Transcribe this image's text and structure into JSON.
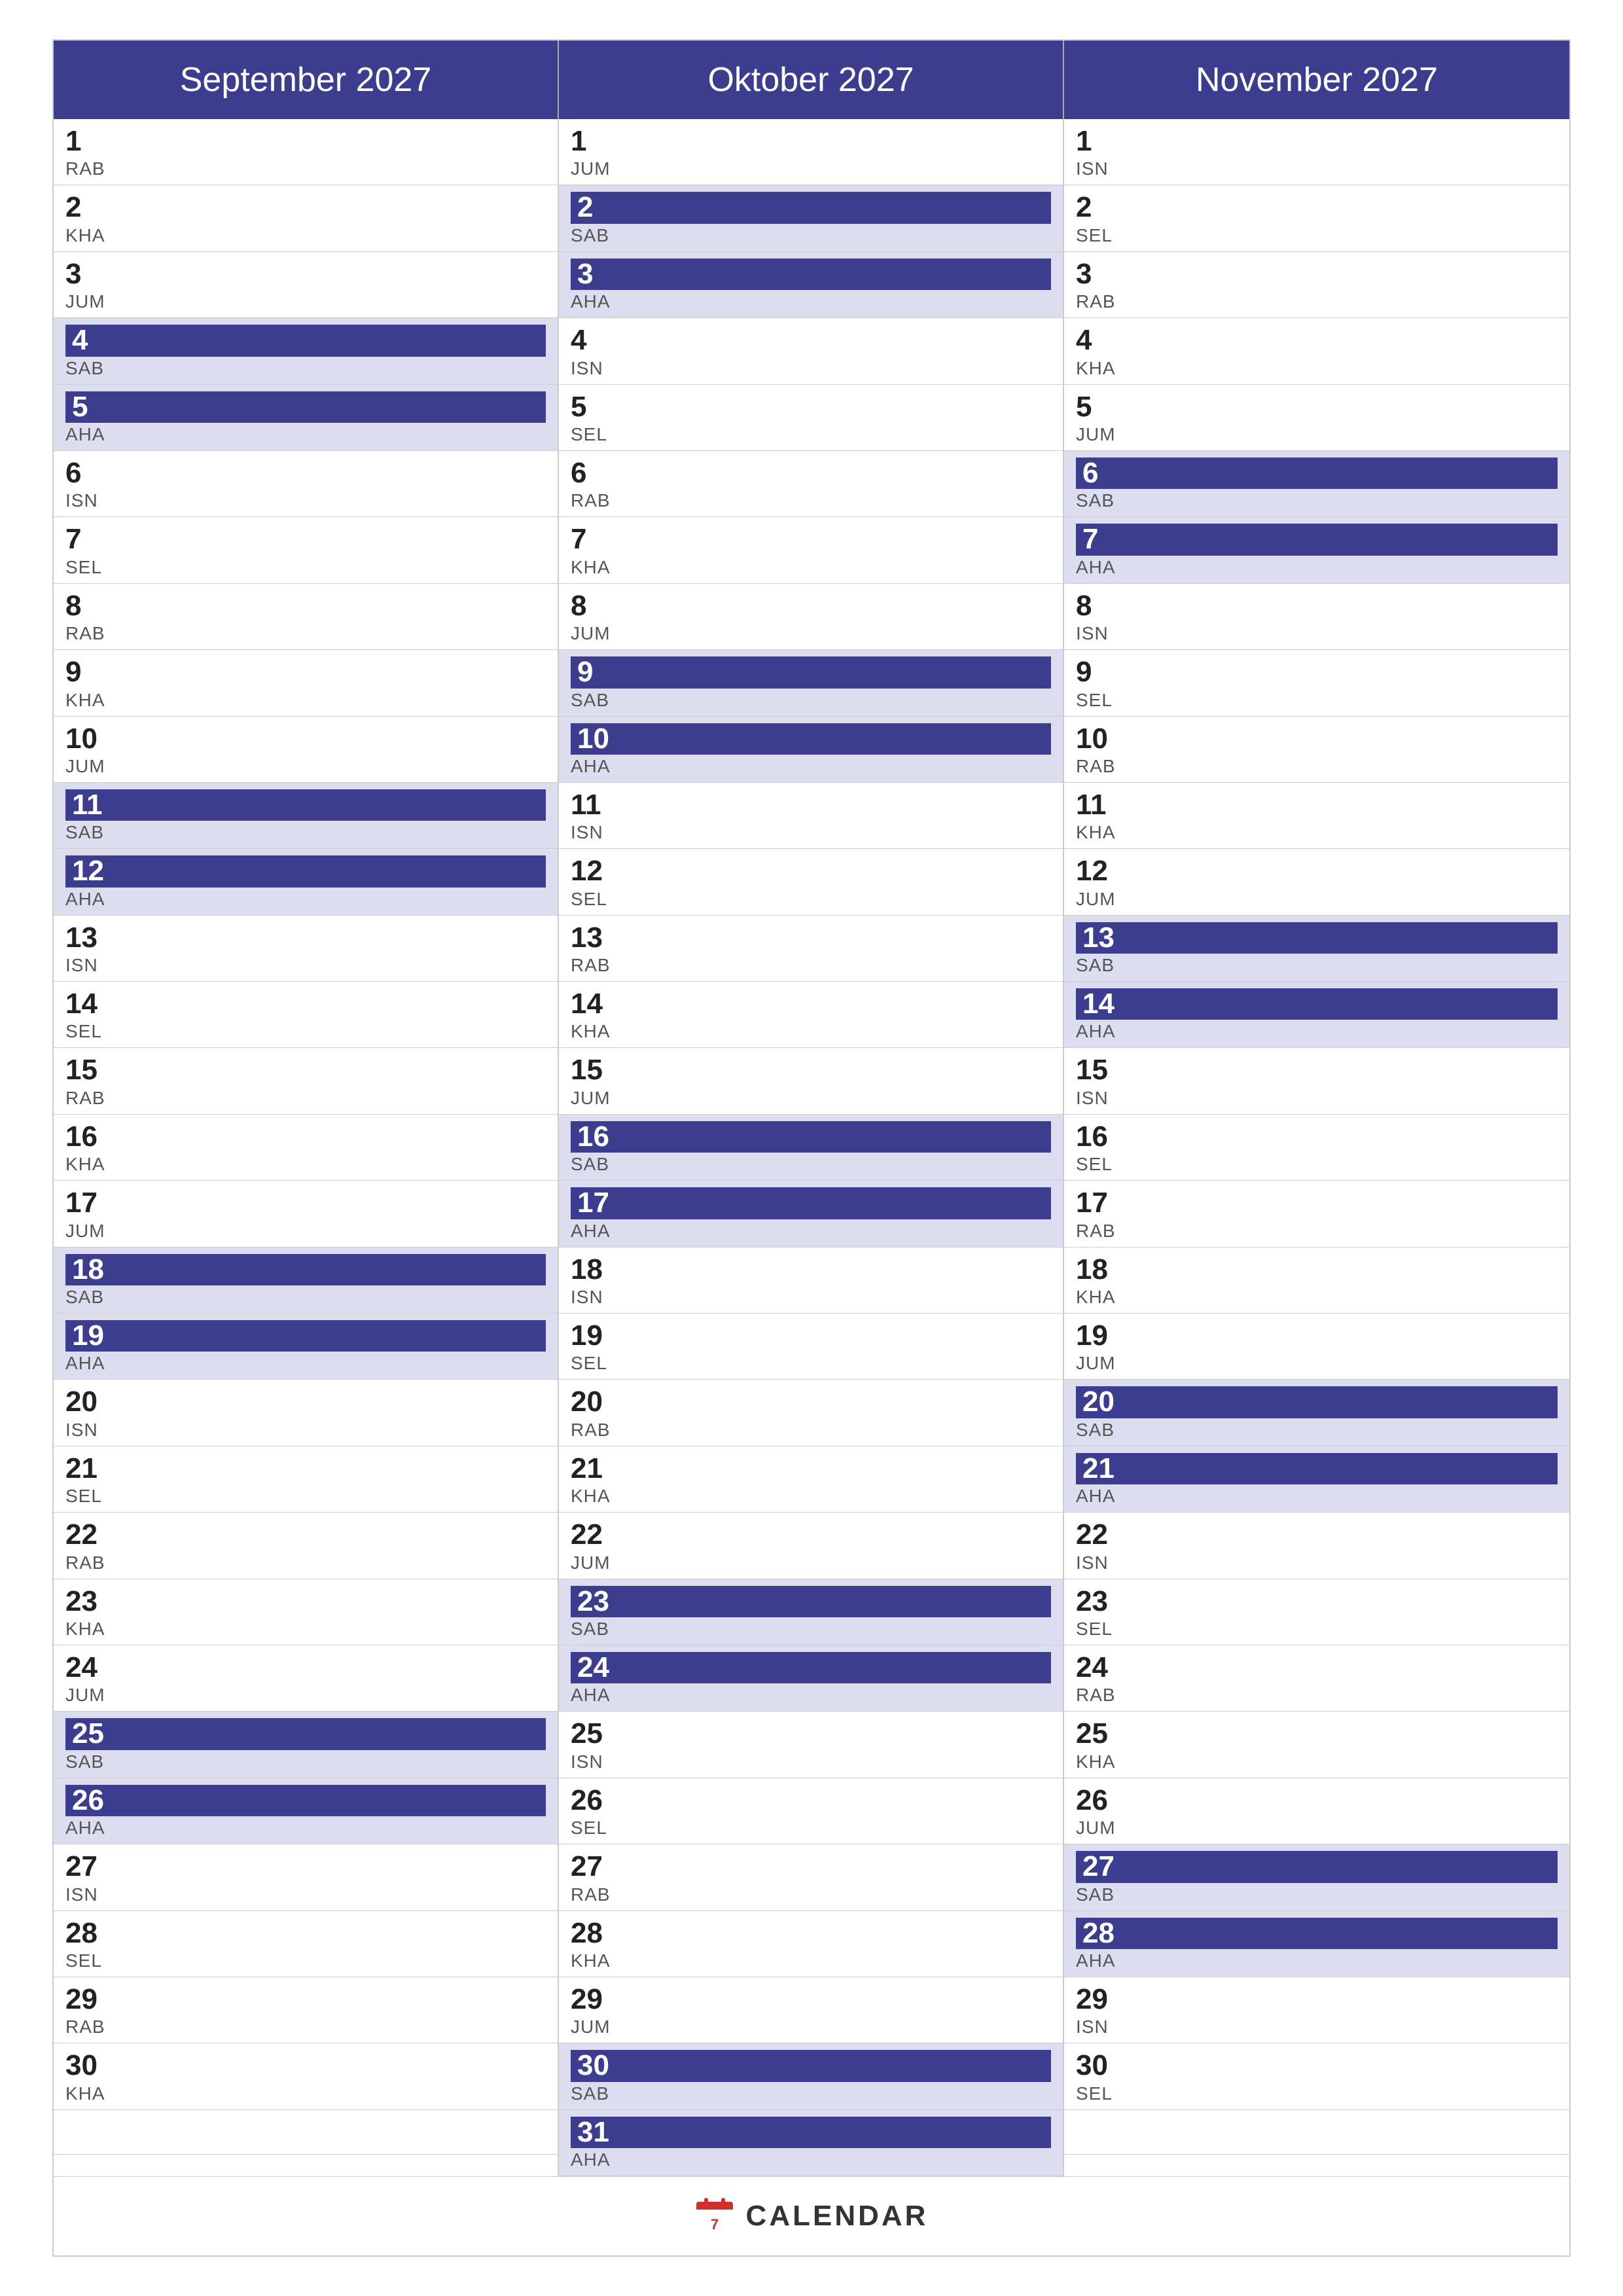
{
  "months": [
    {
      "name": "September 2027",
      "days": [
        {
          "num": "1",
          "label": "RAB",
          "hl": false,
          "hlNum": false
        },
        {
          "num": "2",
          "label": "KHA",
          "hl": false,
          "hlNum": false
        },
        {
          "num": "3",
          "label": "JUM",
          "hl": false,
          "hlNum": false
        },
        {
          "num": "4",
          "label": "SAB",
          "hl": true,
          "hlNum": true
        },
        {
          "num": "5",
          "label": "AHA",
          "hl": true,
          "hlNum": true
        },
        {
          "num": "6",
          "label": "ISN",
          "hl": false,
          "hlNum": false
        },
        {
          "num": "7",
          "label": "SEL",
          "hl": false,
          "hlNum": false
        },
        {
          "num": "8",
          "label": "RAB",
          "hl": false,
          "hlNum": false
        },
        {
          "num": "9",
          "label": "KHA",
          "hl": false,
          "hlNum": false
        },
        {
          "num": "10",
          "label": "JUM",
          "hl": false,
          "hlNum": false
        },
        {
          "num": "11",
          "label": "SAB",
          "hl": true,
          "hlNum": true
        },
        {
          "num": "12",
          "label": "AHA",
          "hl": true,
          "hlNum": true
        },
        {
          "num": "13",
          "label": "ISN",
          "hl": false,
          "hlNum": false
        },
        {
          "num": "14",
          "label": "SEL",
          "hl": false,
          "hlNum": false
        },
        {
          "num": "15",
          "label": "RAB",
          "hl": false,
          "hlNum": false
        },
        {
          "num": "16",
          "label": "KHA",
          "hl": false,
          "hlNum": false
        },
        {
          "num": "17",
          "label": "JUM",
          "hl": false,
          "hlNum": false
        },
        {
          "num": "18",
          "label": "SAB",
          "hl": true,
          "hlNum": true
        },
        {
          "num": "19",
          "label": "AHA",
          "hl": true,
          "hlNum": true
        },
        {
          "num": "20",
          "label": "ISN",
          "hl": false,
          "hlNum": false
        },
        {
          "num": "21",
          "label": "SEL",
          "hl": false,
          "hlNum": false
        },
        {
          "num": "22",
          "label": "RAB",
          "hl": false,
          "hlNum": false
        },
        {
          "num": "23",
          "label": "KHA",
          "hl": false,
          "hlNum": false
        },
        {
          "num": "24",
          "label": "JUM",
          "hl": false,
          "hlNum": false
        },
        {
          "num": "25",
          "label": "SAB",
          "hl": true,
          "hlNum": true
        },
        {
          "num": "26",
          "label": "AHA",
          "hl": true,
          "hlNum": true
        },
        {
          "num": "27",
          "label": "ISN",
          "hl": false,
          "hlNum": false
        },
        {
          "num": "28",
          "label": "SEL",
          "hl": false,
          "hlNum": false
        },
        {
          "num": "29",
          "label": "RAB",
          "hl": false,
          "hlNum": false
        },
        {
          "num": "30",
          "label": "KHA",
          "hl": false,
          "hlNum": false
        }
      ]
    },
    {
      "name": "Oktober 2027",
      "days": [
        {
          "num": "1",
          "label": "JUM",
          "hl": false,
          "hlNum": false
        },
        {
          "num": "2",
          "label": "SAB",
          "hl": true,
          "hlNum": true
        },
        {
          "num": "3",
          "label": "AHA",
          "hl": true,
          "hlNum": true
        },
        {
          "num": "4",
          "label": "ISN",
          "hl": false,
          "hlNum": false
        },
        {
          "num": "5",
          "label": "SEL",
          "hl": false,
          "hlNum": false
        },
        {
          "num": "6",
          "label": "RAB",
          "hl": false,
          "hlNum": false
        },
        {
          "num": "7",
          "label": "KHA",
          "hl": false,
          "hlNum": false
        },
        {
          "num": "8",
          "label": "JUM",
          "hl": false,
          "hlNum": false
        },
        {
          "num": "9",
          "label": "SAB",
          "hl": true,
          "hlNum": true
        },
        {
          "num": "10",
          "label": "AHA",
          "hl": true,
          "hlNum": true
        },
        {
          "num": "11",
          "label": "ISN",
          "hl": false,
          "hlNum": false
        },
        {
          "num": "12",
          "label": "SEL",
          "hl": false,
          "hlNum": false
        },
        {
          "num": "13",
          "label": "RAB",
          "hl": false,
          "hlNum": false
        },
        {
          "num": "14",
          "label": "KHA",
          "hl": false,
          "hlNum": false
        },
        {
          "num": "15",
          "label": "JUM",
          "hl": false,
          "hlNum": false
        },
        {
          "num": "16",
          "label": "SAB",
          "hl": true,
          "hlNum": true
        },
        {
          "num": "17",
          "label": "AHA",
          "hl": true,
          "hlNum": true
        },
        {
          "num": "18",
          "label": "ISN",
          "hl": false,
          "hlNum": false
        },
        {
          "num": "19",
          "label": "SEL",
          "hl": false,
          "hlNum": false
        },
        {
          "num": "20",
          "label": "RAB",
          "hl": false,
          "hlNum": false
        },
        {
          "num": "21",
          "label": "KHA",
          "hl": false,
          "hlNum": false
        },
        {
          "num": "22",
          "label": "JUM",
          "hl": false,
          "hlNum": false
        },
        {
          "num": "23",
          "label": "SAB",
          "hl": true,
          "hlNum": true
        },
        {
          "num": "24",
          "label": "AHA",
          "hl": true,
          "hlNum": true
        },
        {
          "num": "25",
          "label": "ISN",
          "hl": false,
          "hlNum": false
        },
        {
          "num": "26",
          "label": "SEL",
          "hl": false,
          "hlNum": false
        },
        {
          "num": "27",
          "label": "RAB",
          "hl": false,
          "hlNum": false
        },
        {
          "num": "28",
          "label": "KHA",
          "hl": false,
          "hlNum": false
        },
        {
          "num": "29",
          "label": "JUM",
          "hl": false,
          "hlNum": false
        },
        {
          "num": "30",
          "label": "SAB",
          "hl": true,
          "hlNum": true
        },
        {
          "num": "31",
          "label": "AHA",
          "hl": true,
          "hlNum": true
        }
      ]
    },
    {
      "name": "November 2027",
      "days": [
        {
          "num": "1",
          "label": "ISN",
          "hl": false,
          "hlNum": false
        },
        {
          "num": "2",
          "label": "SEL",
          "hl": false,
          "hlNum": false
        },
        {
          "num": "3",
          "label": "RAB",
          "hl": false,
          "hlNum": false
        },
        {
          "num": "4",
          "label": "KHA",
          "hl": false,
          "hlNum": false
        },
        {
          "num": "5",
          "label": "JUM",
          "hl": false,
          "hlNum": false
        },
        {
          "num": "6",
          "label": "SAB",
          "hl": true,
          "hlNum": true
        },
        {
          "num": "7",
          "label": "AHA",
          "hl": true,
          "hlNum": true
        },
        {
          "num": "8",
          "label": "ISN",
          "hl": false,
          "hlNum": false
        },
        {
          "num": "9",
          "label": "SEL",
          "hl": false,
          "hlNum": false
        },
        {
          "num": "10",
          "label": "RAB",
          "hl": false,
          "hlNum": false
        },
        {
          "num": "11",
          "label": "KHA",
          "hl": false,
          "hlNum": false
        },
        {
          "num": "12",
          "label": "JUM",
          "hl": false,
          "hlNum": false
        },
        {
          "num": "13",
          "label": "SAB",
          "hl": true,
          "hlNum": true
        },
        {
          "num": "14",
          "label": "AHA",
          "hl": true,
          "hlNum": true
        },
        {
          "num": "15",
          "label": "ISN",
          "hl": false,
          "hlNum": false
        },
        {
          "num": "16",
          "label": "SEL",
          "hl": false,
          "hlNum": false
        },
        {
          "num": "17",
          "label": "RAB",
          "hl": false,
          "hlNum": false
        },
        {
          "num": "18",
          "label": "KHA",
          "hl": false,
          "hlNum": false
        },
        {
          "num": "19",
          "label": "JUM",
          "hl": false,
          "hlNum": false
        },
        {
          "num": "20",
          "label": "SAB",
          "hl": true,
          "hlNum": true
        },
        {
          "num": "21",
          "label": "AHA",
          "hl": true,
          "hlNum": true
        },
        {
          "num": "22",
          "label": "ISN",
          "hl": false,
          "hlNum": false
        },
        {
          "num": "23",
          "label": "SEL",
          "hl": false,
          "hlNum": false
        },
        {
          "num": "24",
          "label": "RAB",
          "hl": false,
          "hlNum": false
        },
        {
          "num": "25",
          "label": "KHA",
          "hl": false,
          "hlNum": false
        },
        {
          "num": "26",
          "label": "JUM",
          "hl": false,
          "hlNum": false
        },
        {
          "num": "27",
          "label": "SAB",
          "hl": true,
          "hlNum": true
        },
        {
          "num": "28",
          "label": "AHA",
          "hl": true,
          "hlNum": true
        },
        {
          "num": "29",
          "label": "ISN",
          "hl": false,
          "hlNum": false
        },
        {
          "num": "30",
          "label": "SEL",
          "hl": false,
          "hlNum": false
        }
      ]
    }
  ],
  "footer": {
    "logo_text": "CALENDAR",
    "logo_color": "#d32f2f"
  }
}
